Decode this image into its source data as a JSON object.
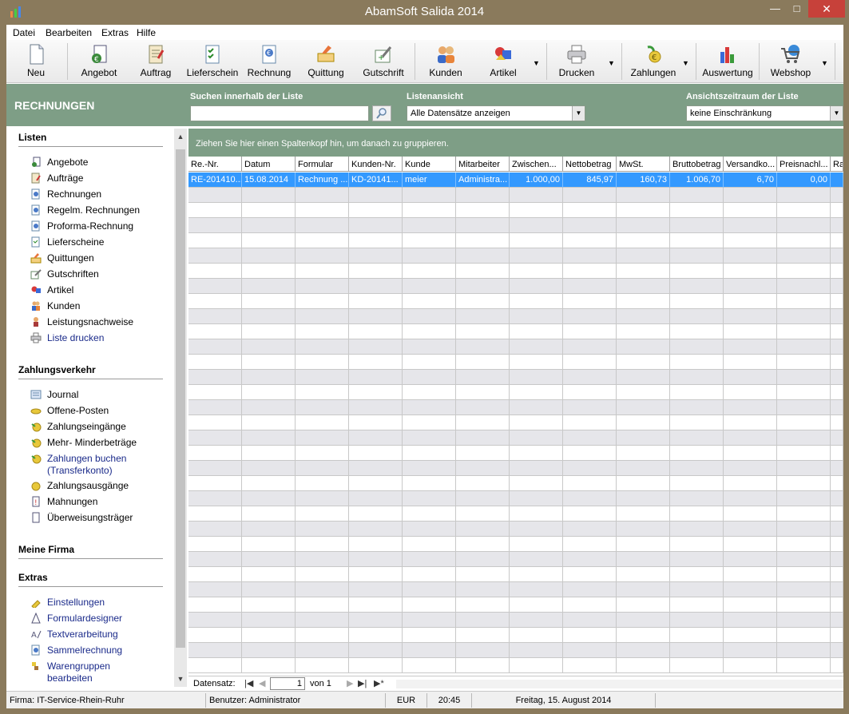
{
  "window": {
    "title": "AbamSoft Salida 2014"
  },
  "menubar": {
    "items": [
      "Datei",
      "Bearbeiten",
      "Extras",
      "Hilfe"
    ]
  },
  "toolbar": {
    "buttons": [
      {
        "label": "Neu",
        "icon": "new-document-icon"
      },
      {
        "label": "Angebot",
        "icon": "offer-icon"
      },
      {
        "label": "Auftrag",
        "icon": "order-icon"
      },
      {
        "label": "Lieferschein",
        "icon": "delivery-note-icon"
      },
      {
        "label": "Rechnung",
        "icon": "invoice-icon"
      },
      {
        "label": "Quittung",
        "icon": "receipt-icon"
      },
      {
        "label": "Gutschrift",
        "icon": "credit-note-icon"
      },
      {
        "label": "Kunden",
        "icon": "customers-icon"
      },
      {
        "label": "Artikel",
        "icon": "articles-icon"
      },
      {
        "label": "Drucken",
        "icon": "printer-icon"
      },
      {
        "label": "Zahlungen",
        "icon": "payments-icon"
      },
      {
        "label": "Auswertung",
        "icon": "chart-icon"
      },
      {
        "label": "Webshop",
        "icon": "cart-icon"
      }
    ]
  },
  "band": {
    "section_title": "RECHNUNGEN",
    "search_label": "Suchen innerhalb der Liste",
    "search_value": "",
    "view_label": "Listenansicht",
    "view_value": "Alle Datensätze anzeigen",
    "period_label": "Ansichtszeitraum der Liste",
    "period_value": "keine Einschränkung"
  },
  "sidebar": {
    "listen_header": "Listen",
    "listen_items": [
      "Angebote",
      "Aufträge",
      "Rechnungen",
      "Regelm. Rechnungen",
      "Proforma-Rechnung",
      "Lieferscheine",
      "Quittungen",
      "Gutschriften",
      "Artikel",
      "Kunden",
      "Leistungsnachweise",
      "Liste drucken"
    ],
    "zahlung_header": "Zahlungsverkehr",
    "zahlung_items": [
      "Journal",
      "Offene-Posten",
      "Zahlungseingänge",
      "Mehr- Minderbeträge",
      "Zahlungen buchen",
      "(Transferkonto)",
      "Zahlungsausgänge",
      "Mahnungen",
      "Überweisungsträger"
    ],
    "firma_header": "Meine Firma",
    "extras_header": "Extras",
    "extras_items": [
      "Einstellungen",
      "Formulardesigner",
      "Textverarbeitung",
      "Sammelrechnung",
      "Warengruppen",
      "bearbeiten"
    ]
  },
  "grid": {
    "group_hint": "Ziehen Sie hier einen Spaltenkopf hin, um danach zu gruppieren.",
    "columns": [
      "Re.-Nr.",
      "Datum",
      "Formular",
      "Kunden-Nr.",
      "Kunde",
      "Mitarbeiter",
      "Zwischen...",
      "Nettobetrag",
      "MwSt.",
      "Bruttobetrag",
      "Versandko...",
      "Preisnachl...",
      "Ra"
    ],
    "rows": [
      [
        "RE-201410...",
        "15.08.2014",
        "Rechnung ...",
        "KD-20141...",
        "meier",
        "Administra...",
        "1.000,00",
        "845,97",
        "160,73",
        "1.006,70",
        "6,70",
        "0,00",
        ""
      ]
    ]
  },
  "pager": {
    "label": "Datensatz:",
    "current": "1",
    "of_text": "von 1"
  },
  "statusbar": {
    "firma": "Firma: IT-Service-Rhein-Ruhr",
    "user": "Benutzer: Administrator",
    "currency": "EUR",
    "time": "20:45",
    "date": "Freitag, 15. August 2014"
  },
  "colors": {
    "title_bar": "#8a7a5c",
    "band_green": "#7e9e86",
    "selection": "#3399ff",
    "close_button": "#c7413a",
    "link_blue": "#1a2a8a"
  }
}
